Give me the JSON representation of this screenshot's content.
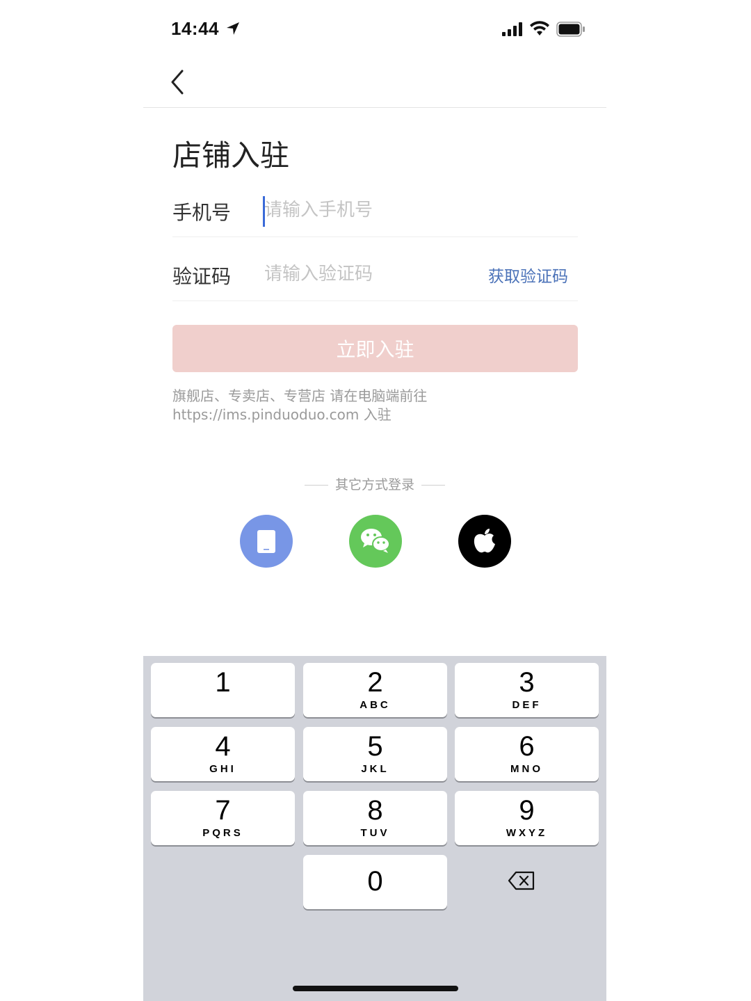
{
  "status_bar": {
    "time": "14:44"
  },
  "page": {
    "title": "店铺入驻"
  },
  "form": {
    "phone_label": "手机号",
    "phone_placeholder": "请输入手机号",
    "code_label": "验证码",
    "code_placeholder": "请输入验证码",
    "get_code_label": "获取验证码",
    "submit_label": "立即入驻"
  },
  "notice": "旗舰店、专卖店、专营店 请在电脑端前往 https://ims.pinduoduo.com 入驻",
  "other_login": {
    "label": "其它方式登录",
    "options": [
      "phone-icon",
      "wechat-icon",
      "apple-icon"
    ]
  },
  "colors": {
    "submit_disabled": "#f0cfcc",
    "link": "#4b72b8",
    "phone_option": "#7896e6",
    "wechat_option": "#64c85a",
    "apple_option": "#000000",
    "keyboard_bg": "#d1d3da"
  },
  "keyboard": {
    "keys": [
      {
        "digit": "1",
        "letters": ""
      },
      {
        "digit": "2",
        "letters": "ABC"
      },
      {
        "digit": "3",
        "letters": "DEF"
      },
      {
        "digit": "4",
        "letters": "GHI"
      },
      {
        "digit": "5",
        "letters": "JKL"
      },
      {
        "digit": "6",
        "letters": "MNO"
      },
      {
        "digit": "7",
        "letters": "PQRS"
      },
      {
        "digit": "8",
        "letters": "TUV"
      },
      {
        "digit": "9",
        "letters": "WXYZ"
      },
      {
        "digit": "0",
        "letters": ""
      }
    ],
    "delete_icon": "backspace-icon"
  }
}
